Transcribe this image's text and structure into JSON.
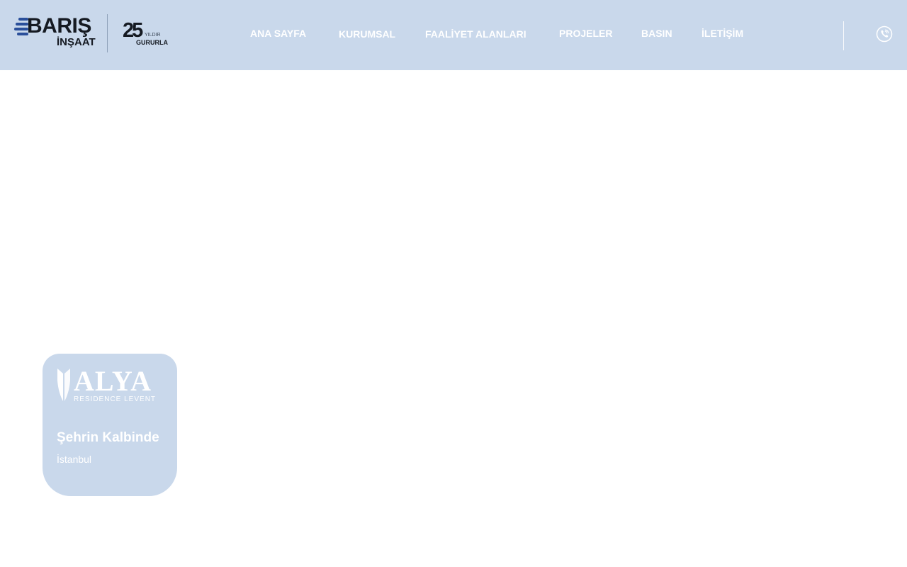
{
  "brand": {
    "name": "BARIŞ",
    "subtitle": "İNŞAAT",
    "anniversary_number": "25",
    "anniversary_top": "YILDIR",
    "anniversary_bottom": "GURURLA",
    "accent_color": "#2a4f9a"
  },
  "nav": {
    "items": [
      {
        "label": "ANA SAYFA"
      },
      {
        "label": "KURUMSAL"
      },
      {
        "label": "FAALİYET ALANLARI"
      },
      {
        "label": "PROJELER"
      },
      {
        "label": "BASIN"
      },
      {
        "label": "İLETİŞİM"
      }
    ]
  },
  "header": {
    "background": "#c9d8eb",
    "phone_icon": "phone-icon"
  },
  "project_card": {
    "logo_name": "ALYA",
    "logo_subtitle": "RESIDENCE LEVENT",
    "title": "Şehrin Kalbinde",
    "city": "İstanbul",
    "background": "#c9d8eb"
  }
}
